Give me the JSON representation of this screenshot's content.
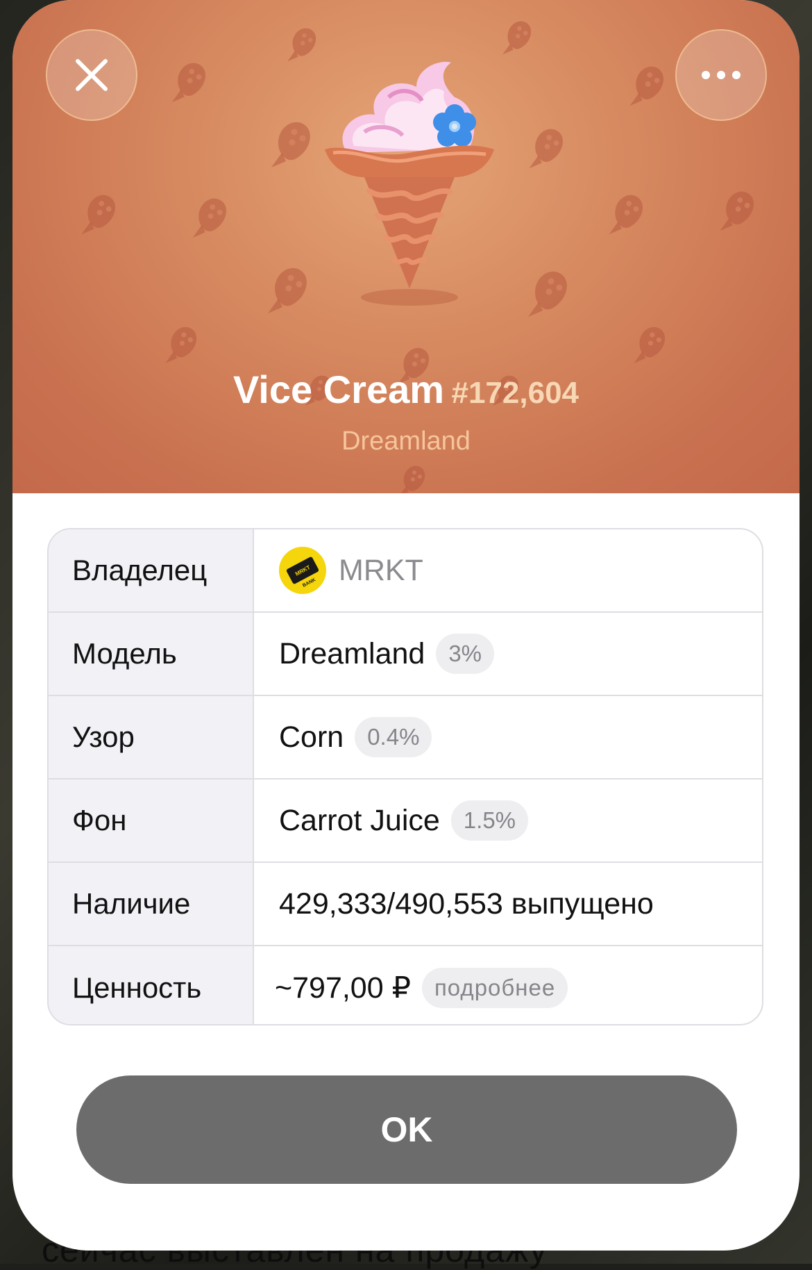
{
  "gift": {
    "name": "Vice Cream",
    "number": "#172,604",
    "model": "Dreamland"
  },
  "header": {
    "close_icon": "close-icon",
    "more_icon": "more-dots-icon",
    "background_color": "#d78a60",
    "pattern_icon": "corn-icon"
  },
  "table": {
    "rows": [
      {
        "label": "Владелец",
        "value": "MRKT",
        "badge": null,
        "avatar_text": [
          "MRKT",
          "BANK"
        ]
      },
      {
        "label": "Модель",
        "value": "Dreamland",
        "badge": "3%"
      },
      {
        "label": "Узор",
        "value": "Corn",
        "badge": "0.4%"
      },
      {
        "label": "Фон",
        "value": "Carrot Juice",
        "badge": "1.5%"
      },
      {
        "label": "Наличие",
        "value": "429,333/490,553 выпущено",
        "badge": null
      },
      {
        "label": "Ценность",
        "value": "~797,00 ₽",
        "badge": "подробнее"
      }
    ]
  },
  "footer": {
    "ok_label": "OK"
  },
  "background_text": "сейчас выставлен на продажу"
}
